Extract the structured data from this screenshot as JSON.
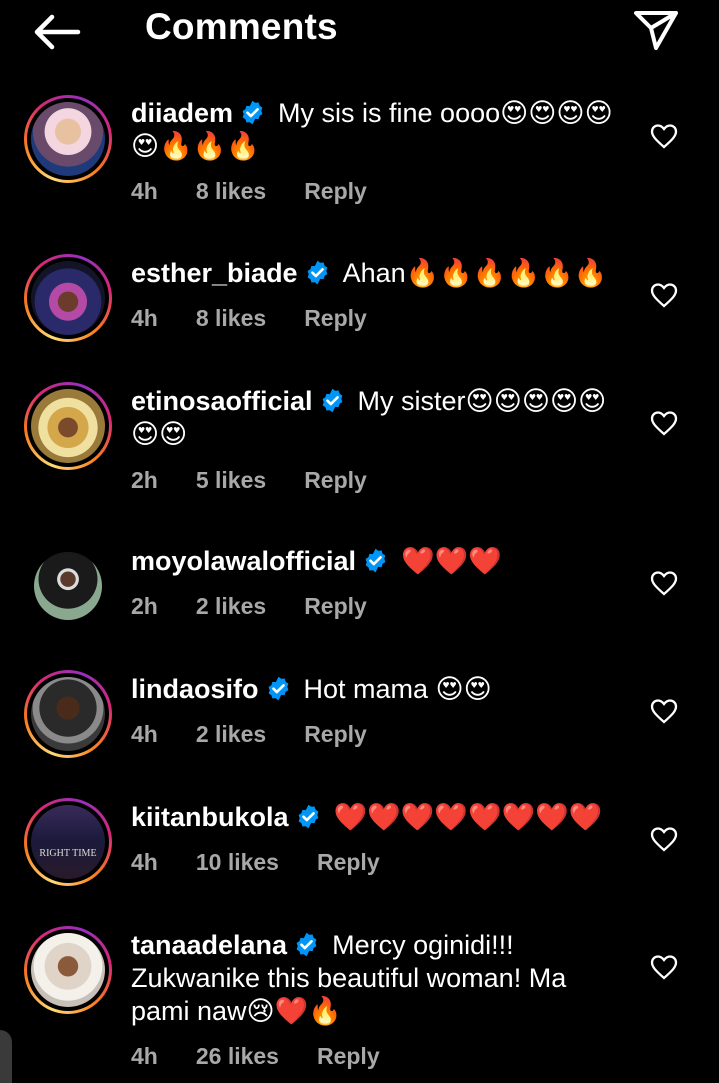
{
  "header": {
    "title": "Comments"
  },
  "comments": [
    {
      "username": "diiadem",
      "text": "My sis is fine oooo😍😍😍😍😍🔥🔥🔥",
      "time": "4h",
      "likes": "8 likes",
      "reply": "Reply"
    },
    {
      "username": "esther_biade",
      "text": "Ahan🔥🔥🔥🔥🔥🔥",
      "time": "4h",
      "likes": "8 likes",
      "reply": "Reply"
    },
    {
      "username": "etinosaofficial",
      "text": "My sister😍😍😍😍😍😍😍",
      "time": "2h",
      "likes": "5 likes",
      "reply": "Reply"
    },
    {
      "username": "moyolawalofficial",
      "text": "❤️❤️❤️",
      "time": "2h",
      "likes": "2 likes",
      "reply": "Reply"
    },
    {
      "username": "lindaosifo",
      "text": "Hot mama 😍😍",
      "time": "4h",
      "likes": "2 likes",
      "reply": "Reply"
    },
    {
      "username": "kiitanbukola",
      "text": "❤️❤️❤️❤️❤️❤️❤️❤️",
      "time": "4h",
      "likes": "10 likes",
      "reply": "Reply"
    },
    {
      "username": "tanaadelana",
      "text": "Mercy oginidi!!! Zukwanike this beautiful woman! Ma pami naw😢❤️🔥",
      "time": "4h",
      "likes": "26 likes",
      "reply": "Reply"
    }
  ],
  "avatar_labels": {
    "kiitanbukola_avatar_text": "RIGHT TIME"
  },
  "colors": {
    "background": "#000000",
    "text": "#ffffff",
    "meta_text": "#a8a8a8",
    "verified_badge": "#0095f6"
  }
}
